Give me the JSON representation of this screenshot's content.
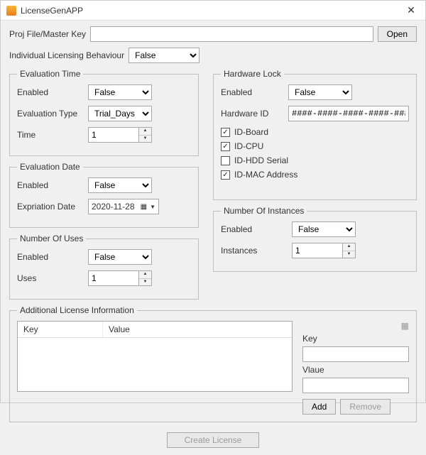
{
  "window": {
    "title": "LicenseGenAPP"
  },
  "proj": {
    "label": "Proj File/Master Key",
    "value": "",
    "open": "Open"
  },
  "indiv": {
    "label": "Individual Licensing Behaviour",
    "value": "False"
  },
  "evalTime": {
    "legend": "Evaluation Time",
    "enabledLabel": "Enabled",
    "enabled": "False",
    "typeLabel": "Evaluation Type",
    "type": "Trial_Days",
    "timeLabel": "Time",
    "time": "1"
  },
  "evalDate": {
    "legend": "Evaluation Date",
    "enabledLabel": "Enabled",
    "enabled": "False",
    "expLabel": "Expriation Date",
    "exp": "2020-11-28"
  },
  "uses": {
    "legend": "Number Of Uses",
    "enabledLabel": "Enabled",
    "enabled": "False",
    "usesLabel": "Uses",
    "uses": "1"
  },
  "hw": {
    "legend": "Hardware Lock",
    "enabledLabel": "Enabled",
    "enabled": "False",
    "idLabel": "Hardware ID",
    "id": "####-####-####-####-####",
    "checks": {
      "board": {
        "label": "ID-Board",
        "checked": true
      },
      "cpu": {
        "label": "ID-CPU",
        "checked": true
      },
      "hdd": {
        "label": "ID-HDD Serial",
        "checked": false
      },
      "mac": {
        "label": "ID-MAC Address",
        "checked": true
      }
    }
  },
  "inst": {
    "legend": "Number Of Instances",
    "enabledLabel": "Enabled",
    "enabled": "False",
    "instLabel": "Instances",
    "inst": "1"
  },
  "addl": {
    "legend": "Additional License Information",
    "colKey": "Key",
    "colVal": "Value",
    "keyLabel": "Key",
    "valLabel": "Vlaue",
    "key": "",
    "val": "",
    "add": "Add",
    "remove": "Remove"
  },
  "footer": {
    "create": "Create License"
  }
}
